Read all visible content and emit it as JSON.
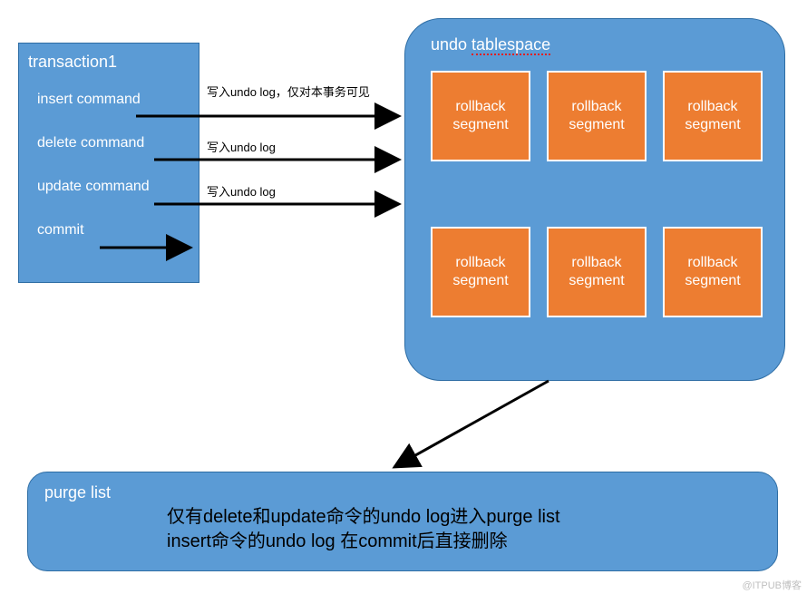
{
  "transaction": {
    "title": "transaction1",
    "commands": {
      "insert": "insert command",
      "delete": "delete command",
      "update": "update command",
      "commit": "commit"
    }
  },
  "arrow_labels": {
    "insert": "写入undo log，仅对本事务可见",
    "delete": "写入undo log",
    "update": "写入undo log"
  },
  "undo": {
    "title_prefix": "undo ",
    "title_word": "tablespace",
    "segment_label": "rollback\nsegment"
  },
  "purge": {
    "title": "purge list",
    "line1": "仅有delete和update命令的undo log进入purge list",
    "line2": "insert命令的undo log 在commit后直接删除"
  },
  "watermark": "@ITPUB博客",
  "colors": {
    "blue": "#5b9bd5",
    "orange": "#ed7d31"
  }
}
